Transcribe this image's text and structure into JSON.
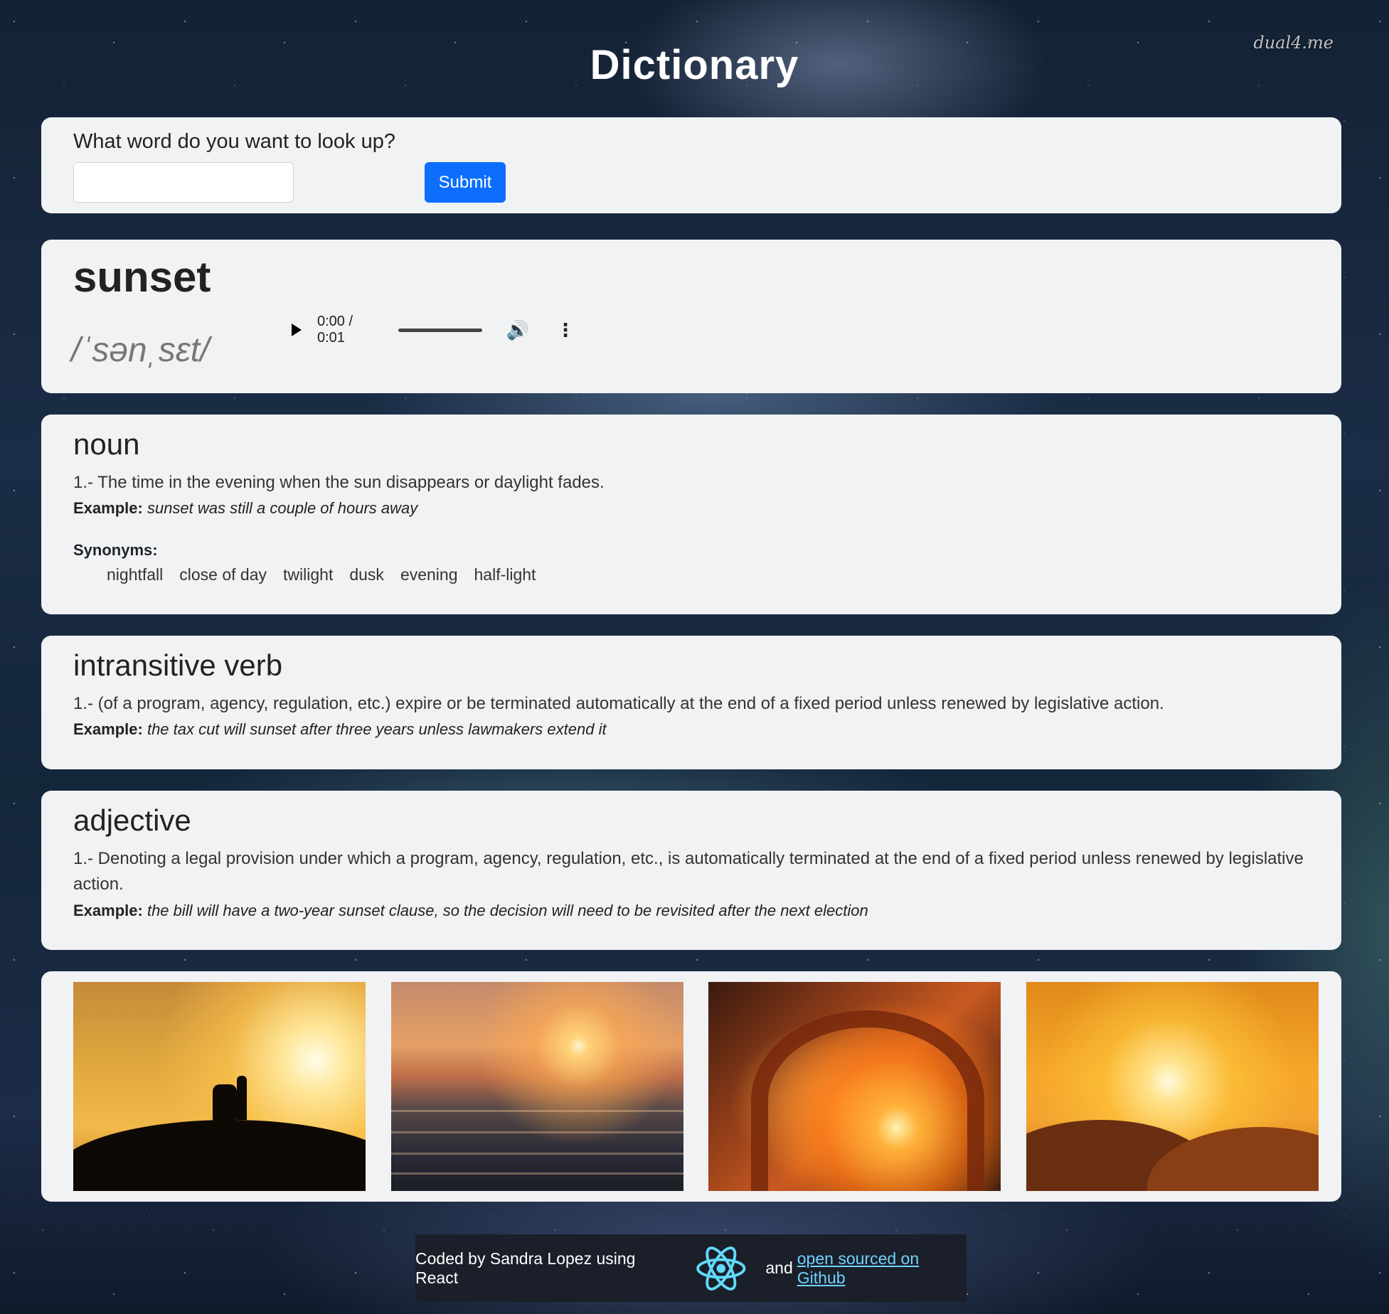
{
  "watermark": "dual4.me",
  "app": {
    "title": "Dictionary"
  },
  "search": {
    "label": "What word do you want to look up?",
    "value": "",
    "placeholder": "",
    "submit_label": "Submit"
  },
  "word": {
    "text": "sunset",
    "phonetic": "/ˈsənˌsɛt/",
    "audio": {
      "time": "0:00 / 0:01",
      "play_icon": "play-icon",
      "volume_icon": "volume-icon",
      "more_icon": "more-options-icon"
    }
  },
  "meanings": [
    {
      "part_of_speech": "noun",
      "definition": "1.- The time in the evening when the sun disappears or daylight fades.",
      "example_label": "Example:",
      "example": "sunset was still a couple of hours away",
      "synonyms_label": "Synonyms:",
      "synonyms": [
        "nightfall",
        "close of day",
        "twilight",
        "dusk",
        "evening",
        "half-light"
      ]
    },
    {
      "part_of_speech": "intransitive verb",
      "definition": "1.- (of a program, agency, regulation, etc.) expire or be terminated automatically at the end of a fixed period unless renewed by legislative action.",
      "example_label": "Example:",
      "example": "the tax cut will sunset after three years unless lawmakers extend it"
    },
    {
      "part_of_speech": "adjective",
      "definition": "1.- Denoting a legal provision under which a program, agency, regulation, etc., is automatically terminated at the end of a fixed period unless renewed by legislative action.",
      "example_label": "Example:",
      "example": "the bill will have a two-year sunset clause, so the decision will need to be revisited after the next election"
    }
  ],
  "footer": {
    "text1": "Coded by Sandra Lopez using React",
    "text2": "and",
    "link_text": "open sourced on Github",
    "icon": "react-icon"
  },
  "colors": {
    "accent": "#0d6efd",
    "card_bg": "#f1f2f4",
    "footer_bg": "#1b1f2a",
    "link": "#6fd3ff"
  }
}
